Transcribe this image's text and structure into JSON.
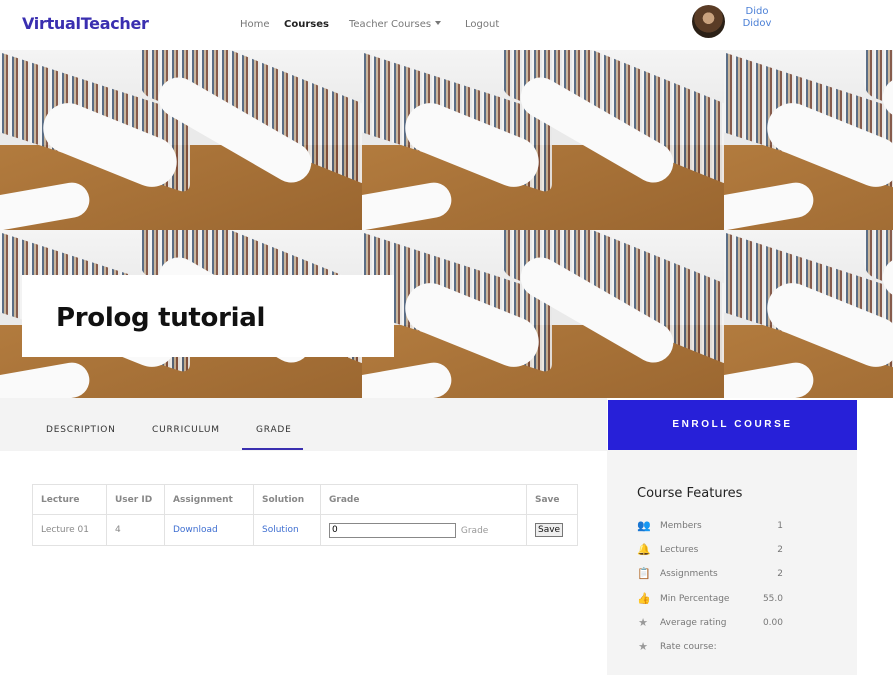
{
  "header": {
    "brand": "VirtualTeacher",
    "nav": {
      "home": "Home",
      "courses": "Courses",
      "teacher_courses": "Teacher Courses",
      "logout": "Logout"
    },
    "user": {
      "first_name": "Dido",
      "last_name": "Didov"
    }
  },
  "course": {
    "title": "Prolog tutorial"
  },
  "tabs": {
    "description": "DESCRIPTION",
    "curriculum": "CURRICULUM",
    "grade": "GRADE",
    "active": "GRADE"
  },
  "enroll_label": "ENROLL COURSE",
  "grade_table": {
    "headers": [
      "Lecture",
      "User ID",
      "Assignment",
      "Solution",
      "Grade",
      "Save"
    ],
    "rows": [
      {
        "lecture": "Lecture 01",
        "user_id": "4",
        "assignment": "Download",
        "solution": "Solution",
        "grade_value": "0",
        "grade_hint": "Grade",
        "save": "Save"
      }
    ]
  },
  "features": {
    "title": "Course Features",
    "items": [
      {
        "icon": "members-icon",
        "label": "Members",
        "value": "1"
      },
      {
        "icon": "bell-icon",
        "label": "Lectures",
        "value": "2"
      },
      {
        "icon": "clipboard-icon",
        "label": "Assignments",
        "value": "2"
      },
      {
        "icon": "thumbs-up-icon",
        "label": "Min Percentage",
        "value": "55.0"
      },
      {
        "icon": "star-icon",
        "label": "Average rating",
        "value": "0.00"
      },
      {
        "icon": "star-icon",
        "label": "Rate course:",
        "value": ""
      }
    ]
  },
  "colors": {
    "brand": "#3a2fb0",
    "enroll_bg": "#2720d8",
    "link": "#3f6fd1"
  }
}
